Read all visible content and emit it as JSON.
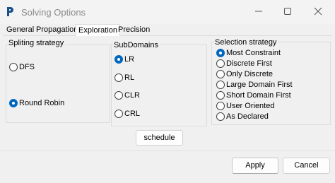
{
  "window": {
    "title": "Solving Options",
    "app_icon": "app-logo-icon",
    "controls": {
      "minimize": "minimize-icon",
      "maximize": "maximize-icon",
      "close": "close-icon"
    }
  },
  "tabs": [
    {
      "label": "General",
      "active": false
    },
    {
      "label": "Propagation",
      "active": false
    },
    {
      "label": "Exploration",
      "active": true
    },
    {
      "label": "Precision",
      "active": false
    }
  ],
  "splitting": {
    "title": "Spliting strategy",
    "options": [
      {
        "label": "DFS",
        "checked": false
      },
      {
        "label": "Round Robin",
        "checked": true
      }
    ]
  },
  "subdomains": {
    "title": "SubDomains",
    "options": [
      {
        "label": "LR",
        "checked": true
      },
      {
        "label": "RL",
        "checked": false
      },
      {
        "label": "CLR",
        "checked": false
      },
      {
        "label": "CRL",
        "checked": false
      }
    ]
  },
  "selection": {
    "title": "Selection strategy",
    "options": [
      {
        "label": "Most Constraint",
        "checked": true
      },
      {
        "label": "Discrete First",
        "checked": false
      },
      {
        "label": "Only Discrete",
        "checked": false
      },
      {
        "label": "Large Domain First",
        "checked": false
      },
      {
        "label": "Short Domain First",
        "checked": false
      },
      {
        "label": "User Oriented",
        "checked": false
      },
      {
        "label": "As Declared",
        "checked": false
      }
    ]
  },
  "buttons": {
    "schedule": "schedule",
    "apply": "Apply",
    "cancel": "Cancel"
  }
}
